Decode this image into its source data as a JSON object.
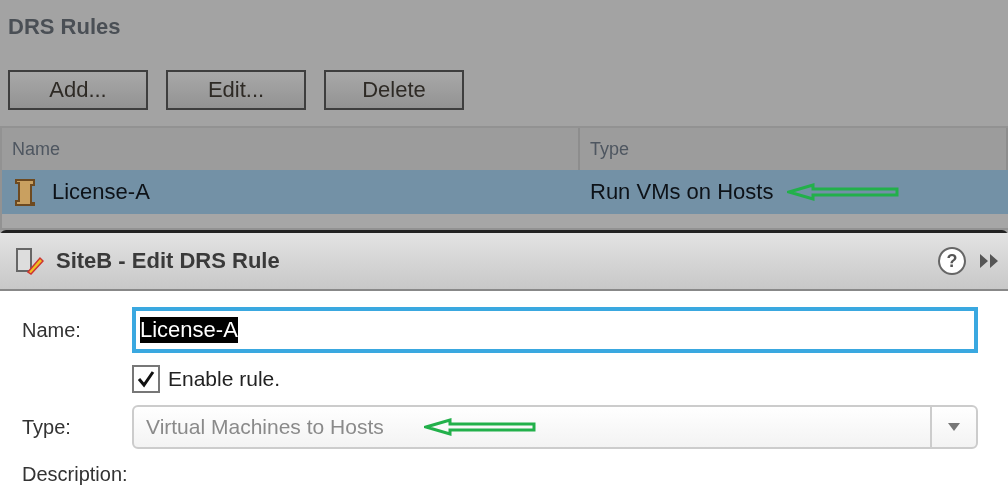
{
  "panel": {
    "title": "DRS Rules"
  },
  "buttons": [
    "Add...",
    "Edit...",
    "Delete"
  ],
  "table": {
    "columns": [
      "Name",
      "Type"
    ],
    "rows": [
      {
        "name": "License-A",
        "type": "Run VMs on Hosts",
        "selected": true,
        "annotated": true
      }
    ]
  },
  "dialog": {
    "title": "SiteB - Edit DRS Rule",
    "help": "?",
    "name_label": "Name:",
    "name_value": "License-A",
    "enable": {
      "label": "Enable rule.",
      "checked": true
    },
    "type_label": "Type:",
    "type_value": "Virtual Machines to Hosts",
    "type_disabled": true,
    "type_annotated": true,
    "description_label": "Description:"
  }
}
